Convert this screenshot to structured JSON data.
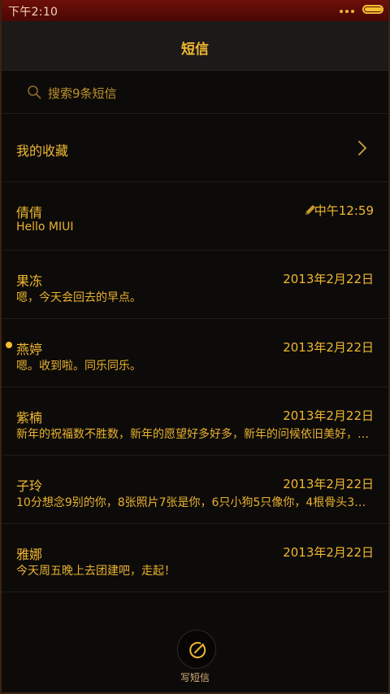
{
  "status_bar": {
    "time": "下午2:10",
    "battery_level": 1.0
  },
  "header": {
    "title": "短信"
  },
  "search": {
    "placeholder": "搜索9条短信"
  },
  "favorites": {
    "label": "我的收藏"
  },
  "messages": [
    {
      "name": "倩倩",
      "time": "中午12:59",
      "preview": "Hello MIUI",
      "draft": true,
      "unread": false
    },
    {
      "name": "果冻",
      "time": "2013年2月22日",
      "preview": "嗯，今天会回去的早点。",
      "draft": false,
      "unread": false
    },
    {
      "name": "燕婷",
      "time": "2013年2月22日",
      "preview": "嗯。收到啦。同乐同乐。",
      "draft": false,
      "unread": true
    },
    {
      "name": "紫楠",
      "time": "2013年2月22日",
      "preview": "新年的祝福数不胜数，新年的愿望好多好多，新年的问候依旧美好，…",
      "draft": false,
      "unread": false
    },
    {
      "name": "子玲",
      "time": "2013年2月22日",
      "preview": "10分想念9别的你，8张照片7张是你，6只小狗5只像你，4根骨头3…",
      "draft": false,
      "unread": false
    },
    {
      "name": "雅娜",
      "time": "2013年2月22日",
      "preview": "今天周五晚上去团建吧，走起！",
      "draft": false,
      "unread": false
    }
  ],
  "compose": {
    "label": "写短信"
  },
  "colors": {
    "accent": "#f0b731",
    "status_bar": "#6e0f0a",
    "background": "#0d0b09"
  }
}
